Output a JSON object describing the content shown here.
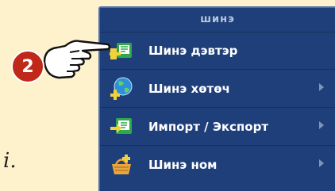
{
  "menu": {
    "header": "шинэ",
    "items": [
      {
        "label": "Шинэ дэвтэр",
        "icon": "new-workbook-icon",
        "submenu": false
      },
      {
        "label": "Шинэ хөтөч",
        "icon": "new-browser-icon",
        "submenu": true
      },
      {
        "label": "Импорт / Экспорт",
        "icon": "import-export-icon",
        "submenu": true
      },
      {
        "label": "Шинэ ном",
        "icon": "new-book-icon",
        "submenu": true
      }
    ]
  },
  "callout": {
    "number": "2"
  },
  "background_text": "i.",
  "colors": {
    "menu_bg": "#1f3f7a",
    "badge": "#c0281a",
    "page_bg": "#fdf2cc",
    "icon_green": "#2ea84a"
  }
}
